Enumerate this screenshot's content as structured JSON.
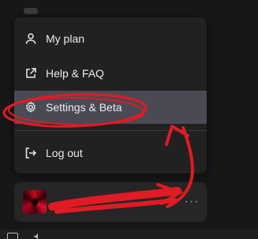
{
  "menu": {
    "items": [
      {
        "label": "My plan",
        "icon": "user-icon"
      },
      {
        "label": "Help & FAQ",
        "icon": "external-link-icon"
      },
      {
        "label": "Settings & Beta",
        "icon": "gear-icon",
        "highlighted": true
      },
      {
        "label": "Log out",
        "icon": "logout-icon"
      }
    ]
  },
  "user_card": {
    "more_label": "···"
  },
  "colors": {
    "menu_bg": "#212121",
    "highlight": "#4a4a55",
    "annotation_red": "#e01b24"
  }
}
